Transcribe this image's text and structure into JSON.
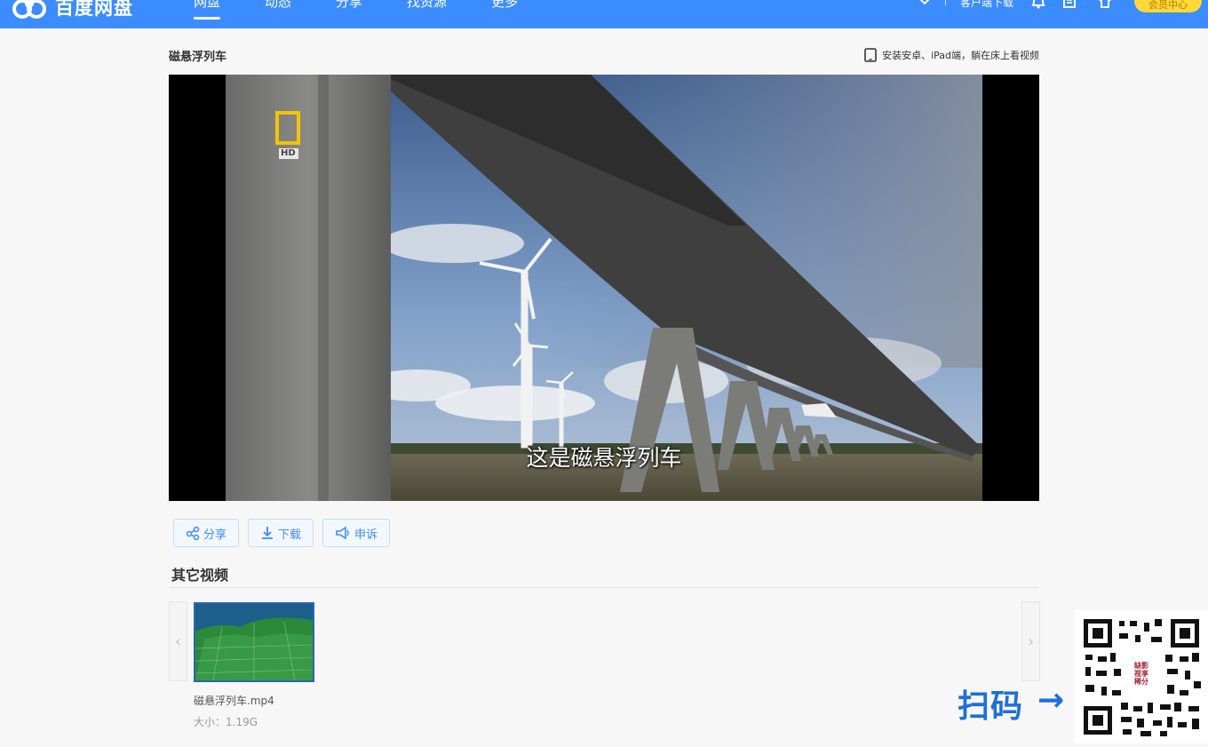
{
  "app": {
    "logo_text": "百度网盘"
  },
  "nav": {
    "items": [
      "网盘",
      "动态",
      "分享",
      "找资源",
      "更多"
    ],
    "active_index": 0
  },
  "top_right": {
    "client_download": "客户端下载",
    "vip_label": "会员中心"
  },
  "page": {
    "title": "磁悬浮列车",
    "install_tip": "安装安卓、iPad端，躺在床上看视频"
  },
  "player": {
    "channel_badge": "HD",
    "subtitle": "这是磁悬浮列车"
  },
  "actions": {
    "share": "分享",
    "download": "下载",
    "report": "申诉"
  },
  "other_videos": {
    "title": "其它视频",
    "items": [
      {
        "name": "磁悬浮列车.mp4",
        "size": "大小：1.19G"
      }
    ],
    "prev_arrow": "‹",
    "next_arrow": "›"
  },
  "qr_overlay": {
    "scan_text": "扫码",
    "arrow": "→",
    "label_line1": "缺影",
    "label_line2": "视享",
    "label_line3": "稀分"
  },
  "colors": {
    "topbar": "#3b8cff",
    "accent": "#3b8cff",
    "vip": "#ffd83a"
  }
}
